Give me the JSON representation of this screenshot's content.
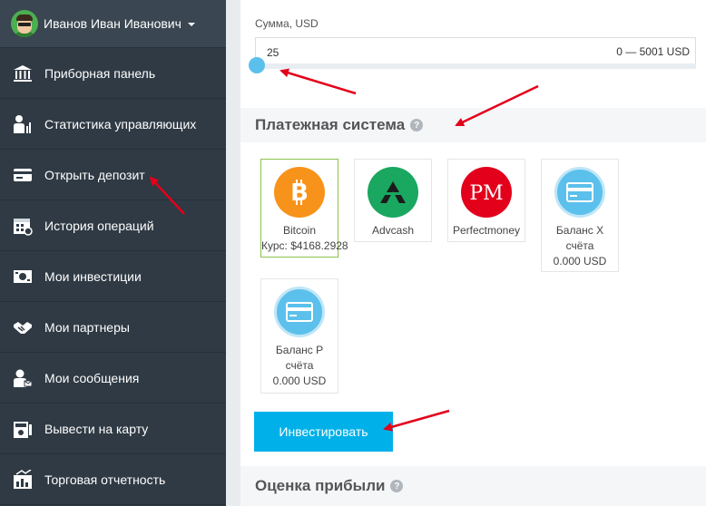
{
  "user": {
    "name": "Иванов Иван Иванович",
    "avatar_icon": "user-avatar-icon"
  },
  "sidebar": {
    "items": [
      {
        "label": "Приборная панель",
        "icon": "dashboard-icon"
      },
      {
        "label": "Статистика управляющих",
        "icon": "statistics-icon"
      },
      {
        "label": "Открыть депозит",
        "icon": "deposit-card-icon"
      },
      {
        "label": "История операций",
        "icon": "calendar-icon"
      },
      {
        "label": "Мои инвестиции",
        "icon": "investments-icon"
      },
      {
        "label": "Мои партнеры",
        "icon": "handshake-icon"
      },
      {
        "label": "Мои сообщения",
        "icon": "messages-icon"
      },
      {
        "label": "Вывести на карту",
        "icon": "withdraw-icon"
      },
      {
        "label": "Торговая отчетность",
        "icon": "report-icon"
      }
    ]
  },
  "amount": {
    "label": "Сумма, USD",
    "value": "25",
    "range": "0 — 5001 USD"
  },
  "payment": {
    "title": "Платежная система",
    "help": "?",
    "systems": [
      {
        "name": "Bitcoin",
        "sub": "Курс: $4168.2928",
        "selected": true,
        "color": "#f7931a",
        "glyph": "B"
      },
      {
        "name": "Advcash",
        "sub": "",
        "selected": false,
        "color": "#1aa760",
        "glyph": "A"
      },
      {
        "name": "Perfectmoney",
        "sub": "",
        "selected": false,
        "color": "#e3001b",
        "glyph": "PM"
      },
      {
        "name": "Баланс X",
        "sub": "счёта",
        "extra": "0.000 USD",
        "selected": false,
        "color": "#5bc0eb",
        "glyph": "card"
      },
      {
        "name": "Баланс P",
        "sub": "счёта",
        "extra": "0.000 USD",
        "selected": false,
        "color": "#5bc0eb",
        "glyph": "card"
      }
    ]
  },
  "invest_button": "Инвестировать",
  "profit": {
    "title": "Оценка прибыли",
    "help": "?"
  },
  "colors": {
    "sidebar": "#2f3a44",
    "accent": "#00b0e8",
    "arrow": "#e3001b",
    "selected_border": "#8bc34a"
  }
}
